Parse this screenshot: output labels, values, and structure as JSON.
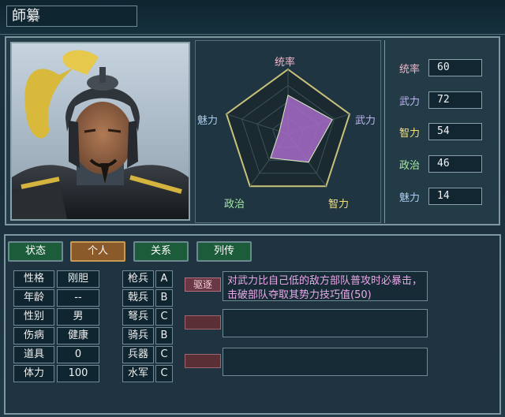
{
  "character": {
    "name": "師纂"
  },
  "radar": {
    "labels": {
      "command": "统率",
      "force": "武力",
      "intel": "智力",
      "politics": "政治",
      "charm": "魅力"
    },
    "values": [
      60,
      72,
      54,
      46,
      14
    ],
    "max": 100
  },
  "stats": [
    {
      "label": "统率",
      "value": "60",
      "color": "#f0b8c8"
    },
    {
      "label": "武力",
      "value": "72",
      "color": "#bcb6ee"
    },
    {
      "label": "智力",
      "value": "54",
      "color": "#f6e07a"
    },
    {
      "label": "政治",
      "value": "46",
      "color": "#a6e8a6"
    },
    {
      "label": "魅力",
      "value": "14",
      "color": "#a9cef0"
    }
  ],
  "tabs": [
    {
      "label": "状态",
      "active": false
    },
    {
      "label": "个人",
      "active": true
    },
    {
      "label": "关系",
      "active": false
    },
    {
      "label": "列传",
      "active": false
    }
  ],
  "personal": [
    {
      "label": "性格",
      "value": "刚胆"
    },
    {
      "label": "年龄",
      "value": "--"
    },
    {
      "label": "性别",
      "value": "男"
    },
    {
      "label": "伤病",
      "value": "健康"
    },
    {
      "label": "道具",
      "value": "0"
    },
    {
      "label": "体力",
      "value": "100"
    }
  ],
  "aptitude": [
    {
      "label": "枪兵",
      "grade": "A"
    },
    {
      "label": "戟兵",
      "grade": "B"
    },
    {
      "label": "弩兵",
      "grade": "C"
    },
    {
      "label": "骑兵",
      "grade": "B"
    },
    {
      "label": "兵器",
      "grade": "C"
    },
    {
      "label": "水军",
      "grade": "C"
    }
  ],
  "skills": [
    {
      "name": "驱逐",
      "desc": "对武力比自己低的敌方部队普攻时必暴击，击破部队夺取其势力技巧值(50)"
    },
    {
      "name": "",
      "desc": ""
    },
    {
      "name": "",
      "desc": ""
    }
  ],
  "colors": {
    "tab_green": "#1d5c3a",
    "tab_active": "#8a5a2b",
    "skill_text": "#e9a7e8"
  }
}
